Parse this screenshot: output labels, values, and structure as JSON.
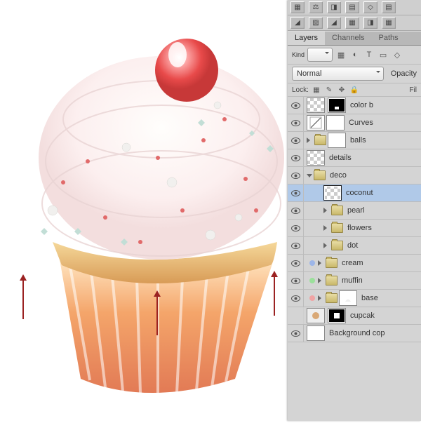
{
  "tabs": {
    "layers": "Layers",
    "channels": "Channels",
    "paths": "Paths"
  },
  "kind": {
    "label": "Kind",
    "icons": [
      "▦",
      "◐",
      "T",
      "▭",
      "◇"
    ]
  },
  "blend": {
    "mode": "Normal",
    "opacity_label": "Opacity"
  },
  "lock": {
    "label": "Lock:",
    "fill_label": "Fil"
  },
  "layers": {
    "color_balance": "color b",
    "curves": "Curves",
    "balls": "balls",
    "details": "details",
    "deco": "deco",
    "coconut": "coconut",
    "pearl": "pearl",
    "flowers": "flowers",
    "dot": "dot",
    "cream": "cream",
    "muffin": "muffin",
    "base": "base",
    "cupcake": "cupcak",
    "background_copy": "Background cop"
  }
}
